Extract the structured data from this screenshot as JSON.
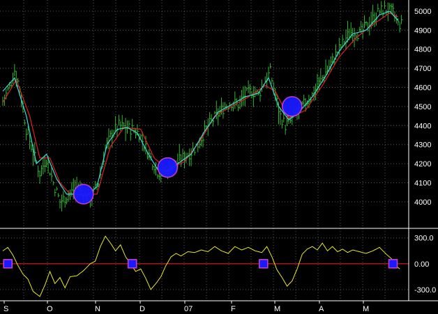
{
  "chart_data": [
    {
      "type": "bar",
      "subtype": "ohlc-price-with-moving-averages",
      "title": "",
      "xlabel": "",
      "ylabel": "",
      "x_tick_labels": [
        "S",
        "O",
        "N",
        "D",
        "07",
        "F",
        "M",
        "A",
        "M"
      ],
      "y_ticks": [
        4000,
        4100,
        4200,
        4300,
        4400,
        4500,
        4600,
        4700,
        4800,
        4900,
        5000
      ],
      "y_tick_labels": [
        "4000",
        "4100",
        "4200",
        "4300",
        "4400",
        "4500",
        "4600",
        "4700",
        "4800",
        "4900",
        "5000"
      ],
      "ylim": [
        3890,
        5040
      ],
      "grid": true,
      "colors": {
        "bars": "#2db82d",
        "ma_fast": "#40d8e0",
        "ma_slow": "#e02020",
        "marker": "#1a1aff",
        "marker_outline": "#d040d0",
        "grid": "#5a5a5a",
        "axis": "#ffffff",
        "background": "#000000"
      },
      "close_series": [
        {
          "i": 0,
          "v": 4530
        },
        {
          "i": 4,
          "v": 4600
        },
        {
          "i": 7,
          "v": 4690
        },
        {
          "i": 10,
          "v": 4600
        },
        {
          "i": 14,
          "v": 4380
        },
        {
          "i": 18,
          "v": 4260
        },
        {
          "i": 22,
          "v": 4150
        },
        {
          "i": 26,
          "v": 4230
        },
        {
          "i": 30,
          "v": 4100
        },
        {
          "i": 34,
          "v": 4000
        },
        {
          "i": 38,
          "v": 4030
        },
        {
          "i": 42,
          "v": 4060
        },
        {
          "i": 45,
          "v": 4080
        },
        {
          "i": 49,
          "v": 4040
        },
        {
          "i": 53,
          "v": 4030
        },
        {
          "i": 57,
          "v": 4100
        },
        {
          "i": 61,
          "v": 4280
        },
        {
          "i": 65,
          "v": 4360
        },
        {
          "i": 69,
          "v": 4400
        },
        {
          "i": 73,
          "v": 4390
        },
        {
          "i": 77,
          "v": 4380
        },
        {
          "i": 81,
          "v": 4360
        },
        {
          "i": 84,
          "v": 4300
        },
        {
          "i": 88,
          "v": 4230
        },
        {
          "i": 92,
          "v": 4160
        },
        {
          "i": 96,
          "v": 4150
        },
        {
          "i": 100,
          "v": 4180
        },
        {
          "i": 104,
          "v": 4210
        },
        {
          "i": 108,
          "v": 4240
        },
        {
          "i": 112,
          "v": 4260
        },
        {
          "i": 116,
          "v": 4300
        },
        {
          "i": 120,
          "v": 4370
        },
        {
          "i": 124,
          "v": 4420
        },
        {
          "i": 128,
          "v": 4460
        },
        {
          "i": 132,
          "v": 4500
        },
        {
          "i": 136,
          "v": 4520
        },
        {
          "i": 140,
          "v": 4510
        },
        {
          "i": 144,
          "v": 4560
        },
        {
          "i": 148,
          "v": 4580
        },
        {
          "i": 152,
          "v": 4560
        },
        {
          "i": 156,
          "v": 4640
        },
        {
          "i": 159,
          "v": 4680
        },
        {
          "i": 162,
          "v": 4560
        },
        {
          "i": 165,
          "v": 4450
        },
        {
          "i": 168,
          "v": 4400
        },
        {
          "i": 172,
          "v": 4430
        },
        {
          "i": 176,
          "v": 4480
        },
        {
          "i": 180,
          "v": 4520
        },
        {
          "i": 184,
          "v": 4560
        },
        {
          "i": 188,
          "v": 4620
        },
        {
          "i": 192,
          "v": 4680
        },
        {
          "i": 196,
          "v": 4740
        },
        {
          "i": 200,
          "v": 4800
        },
        {
          "i": 204,
          "v": 4860
        },
        {
          "i": 208,
          "v": 4900
        },
        {
          "i": 212,
          "v": 4880
        },
        {
          "i": 216,
          "v": 4920
        },
        {
          "i": 220,
          "v": 4960
        },
        {
          "i": 224,
          "v": 5000
        },
        {
          "i": 228,
          "v": 5010
        },
        {
          "i": 232,
          "v": 4990
        },
        {
          "i": 235,
          "v": 4930
        }
      ],
      "ma_fast": [
        {
          "i": 0,
          "v": 4580
        },
        {
          "i": 7,
          "v": 4650
        },
        {
          "i": 14,
          "v": 4450
        },
        {
          "i": 20,
          "v": 4200
        },
        {
          "i": 26,
          "v": 4250
        },
        {
          "i": 32,
          "v": 4120
        },
        {
          "i": 38,
          "v": 4040
        },
        {
          "i": 44,
          "v": 4040
        },
        {
          "i": 50,
          "v": 4030
        },
        {
          "i": 56,
          "v": 4080
        },
        {
          "i": 62,
          "v": 4300
        },
        {
          "i": 68,
          "v": 4380
        },
        {
          "i": 74,
          "v": 4390
        },
        {
          "i": 80,
          "v": 4360
        },
        {
          "i": 86,
          "v": 4260
        },
        {
          "i": 92,
          "v": 4170
        },
        {
          "i": 98,
          "v": 4160
        },
        {
          "i": 104,
          "v": 4200
        },
        {
          "i": 112,
          "v": 4250
        },
        {
          "i": 120,
          "v": 4370
        },
        {
          "i": 128,
          "v": 4470
        },
        {
          "i": 136,
          "v": 4510
        },
        {
          "i": 144,
          "v": 4550
        },
        {
          "i": 152,
          "v": 4570
        },
        {
          "i": 158,
          "v": 4650
        },
        {
          "i": 164,
          "v": 4500
        },
        {
          "i": 170,
          "v": 4430
        },
        {
          "i": 176,
          "v": 4470
        },
        {
          "i": 184,
          "v": 4550
        },
        {
          "i": 192,
          "v": 4660
        },
        {
          "i": 200,
          "v": 4790
        },
        {
          "i": 208,
          "v": 4880
        },
        {
          "i": 216,
          "v": 4900
        },
        {
          "i": 224,
          "v": 4980
        },
        {
          "i": 230,
          "v": 5000
        },
        {
          "i": 235,
          "v": 4950
        }
      ],
      "ma_slow": [
        {
          "i": 0,
          "v": 4520
        },
        {
          "i": 8,
          "v": 4640
        },
        {
          "i": 16,
          "v": 4450
        },
        {
          "i": 22,
          "v": 4230
        },
        {
          "i": 28,
          "v": 4230
        },
        {
          "i": 34,
          "v": 4100
        },
        {
          "i": 40,
          "v": 4040
        },
        {
          "i": 48,
          "v": 4040
        },
        {
          "i": 56,
          "v": 4040
        },
        {
          "i": 64,
          "v": 4290
        },
        {
          "i": 72,
          "v": 4390
        },
        {
          "i": 82,
          "v": 4380
        },
        {
          "i": 90,
          "v": 4230
        },
        {
          "i": 98,
          "v": 4170
        },
        {
          "i": 108,
          "v": 4210
        },
        {
          "i": 118,
          "v": 4330
        },
        {
          "i": 126,
          "v": 4450
        },
        {
          "i": 136,
          "v": 4500
        },
        {
          "i": 146,
          "v": 4550
        },
        {
          "i": 156,
          "v": 4610
        },
        {
          "i": 162,
          "v": 4580
        },
        {
          "i": 170,
          "v": 4440
        },
        {
          "i": 180,
          "v": 4480
        },
        {
          "i": 190,
          "v": 4610
        },
        {
          "i": 200,
          "v": 4760
        },
        {
          "i": 210,
          "v": 4860
        },
        {
          "i": 220,
          "v": 4930
        },
        {
          "i": 230,
          "v": 4990
        },
        {
          "i": 235,
          "v": 4970
        }
      ],
      "highlight_markers": [
        {
          "i": 48,
          "v": 4040
        },
        {
          "i": 98,
          "v": 4180
        },
        {
          "i": 172,
          "v": 4500
        }
      ]
    },
    {
      "type": "line",
      "subtype": "oscillator",
      "title": "",
      "y_ticks": [
        300,
        0,
        -300
      ],
      "y_tick_labels": [
        "300.0",
        "0.00",
        "-300.0"
      ],
      "ylim": [
        -430,
        330
      ],
      "zero_line": 0,
      "colors": {
        "line": "#e8e820",
        "zero": "#e02020",
        "marker": "#1a1aff",
        "marker_outline": "#d040d0"
      },
      "series": [
        {
          "values_by_index": [
            {
              "i": 0,
              "v": 150
            },
            {
              "i": 3,
              "v": 190
            },
            {
              "i": 6,
              "v": 100
            },
            {
              "i": 9,
              "v": -20
            },
            {
              "i": 12,
              "v": -120
            },
            {
              "i": 15,
              "v": -180
            },
            {
              "i": 18,
              "v": -320
            },
            {
              "i": 22,
              "v": -380
            },
            {
              "i": 25,
              "v": -250
            },
            {
              "i": 28,
              "v": -90
            },
            {
              "i": 31,
              "v": -230
            },
            {
              "i": 34,
              "v": -160
            },
            {
              "i": 37,
              "v": -280
            },
            {
              "i": 40,
              "v": -150
            },
            {
              "i": 44,
              "v": -140
            },
            {
              "i": 48,
              "v": -80
            },
            {
              "i": 52,
              "v": 0
            },
            {
              "i": 55,
              "v": 30
            },
            {
              "i": 58,
              "v": 200
            },
            {
              "i": 61,
              "v": 320
            },
            {
              "i": 64,
              "v": 240
            },
            {
              "i": 67,
              "v": 150
            },
            {
              "i": 70,
              "v": 220
            },
            {
              "i": 73,
              "v": 80
            },
            {
              "i": 76,
              "v": 0
            },
            {
              "i": 79,
              "v": -90
            },
            {
              "i": 82,
              "v": -60
            },
            {
              "i": 85,
              "v": -170
            },
            {
              "i": 88,
              "v": -300
            },
            {
              "i": 91,
              "v": -230
            },
            {
              "i": 94,
              "v": -150
            },
            {
              "i": 97,
              "v": -20
            },
            {
              "i": 100,
              "v": 80
            },
            {
              "i": 103,
              "v": 120
            },
            {
              "i": 106,
              "v": 90
            },
            {
              "i": 110,
              "v": 140
            },
            {
              "i": 114,
              "v": 130
            },
            {
              "i": 118,
              "v": 160
            },
            {
              "i": 122,
              "v": 140
            },
            {
              "i": 126,
              "v": 200
            },
            {
              "i": 130,
              "v": 150
            },
            {
              "i": 134,
              "v": 120
            },
            {
              "i": 138,
              "v": 200
            },
            {
              "i": 142,
              "v": 160
            },
            {
              "i": 146,
              "v": 190
            },
            {
              "i": 150,
              "v": 150
            },
            {
              "i": 154,
              "v": 130
            },
            {
              "i": 157,
              "v": 200
            },
            {
              "i": 160,
              "v": 80
            },
            {
              "i": 163,
              "v": -70
            },
            {
              "i": 166,
              "v": -160
            },
            {
              "i": 169,
              "v": -260
            },
            {
              "i": 172,
              "v": -200
            },
            {
              "i": 175,
              "v": -60
            },
            {
              "i": 178,
              "v": 110
            },
            {
              "i": 181,
              "v": 170
            },
            {
              "i": 184,
              "v": 200
            },
            {
              "i": 187,
              "v": 160
            },
            {
              "i": 190,
              "v": 240
            },
            {
              "i": 193,
              "v": 150
            },
            {
              "i": 196,
              "v": 200
            },
            {
              "i": 199,
              "v": 140
            },
            {
              "i": 202,
              "v": 170
            },
            {
              "i": 205,
              "v": 130
            },
            {
              "i": 208,
              "v": 160
            },
            {
              "i": 212,
              "v": 140
            },
            {
              "i": 216,
              "v": 120
            },
            {
              "i": 220,
              "v": 150
            },
            {
              "i": 224,
              "v": 190
            },
            {
              "i": 228,
              "v": 110
            },
            {
              "i": 231,
              "v": 60
            },
            {
              "i": 234,
              "v": -30
            },
            {
              "i": 236,
              "v": -60
            }
          ]
        }
      ],
      "crossing_markers": [
        3,
        77,
        155,
        232
      ]
    }
  ]
}
